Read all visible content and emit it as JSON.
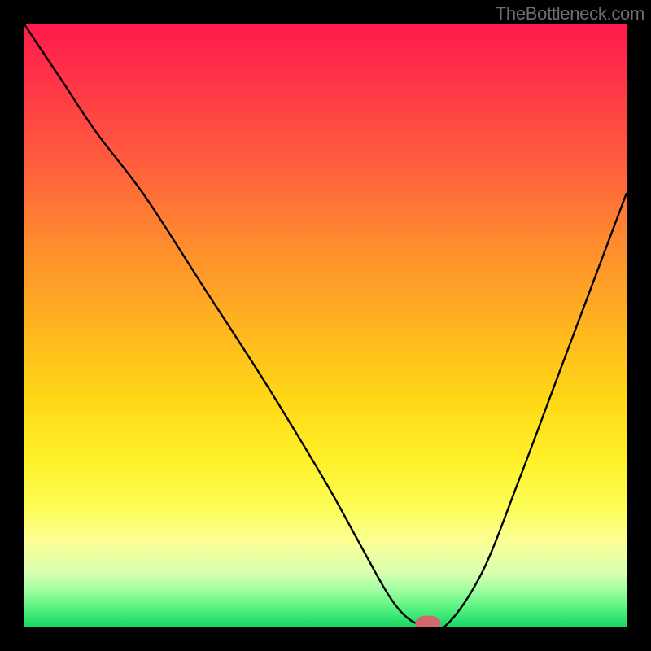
{
  "watermark": "TheBottleneck.com",
  "chart_data": {
    "type": "line",
    "title": "",
    "xlabel": "",
    "ylabel": "",
    "xlim": [
      0,
      100
    ],
    "ylim": [
      0,
      100
    ],
    "grid": false,
    "legend": false,
    "background_gradient": {
      "stops": [
        {
          "offset": 0.0,
          "color": "#ff1a4b"
        },
        {
          "offset": 0.22,
          "color": "#ff5a3e"
        },
        {
          "offset": 0.5,
          "color": "#ffb41f"
        },
        {
          "offset": 0.72,
          "color": "#fff028"
        },
        {
          "offset": 0.86,
          "color": "#fbff96"
        },
        {
          "offset": 0.97,
          "color": "#55f27e"
        },
        {
          "offset": 1.0,
          "color": "#18d867"
        }
      ]
    },
    "series": [
      {
        "name": "bottleneck-curve",
        "x": [
          0,
          6,
          12,
          20,
          30,
          40,
          50,
          55,
          60,
          63,
          66,
          70,
          76,
          82,
          88,
          94,
          100
        ],
        "y": [
          100,
          91,
          82,
          71.5,
          56,
          40.5,
          24,
          15,
          6,
          2,
          0.2,
          0.2,
          9,
          24,
          40,
          56,
          72
        ]
      }
    ],
    "marker": {
      "name": "optimal-point",
      "x": 67,
      "y": 0.5,
      "shape": "rounded-rect",
      "color": "#d06a6a"
    }
  }
}
